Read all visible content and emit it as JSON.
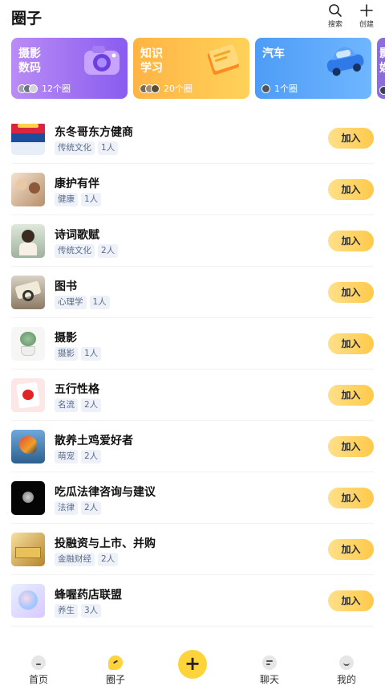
{
  "header": {
    "title": "圈子",
    "search_label": "搜索",
    "create_label": "创建"
  },
  "categories": [
    {
      "label": "摄影\n数码",
      "count": "12个圈",
      "color_from": "#b98cf5",
      "color_to": "#8a5cf0",
      "icon": "camera-icon"
    },
    {
      "label": "知识\n学习",
      "count": "20个圈",
      "color_from": "#ffb444",
      "color_to": "#ffd25a",
      "icon": "book-icon"
    },
    {
      "label": "汽车",
      "count": "1个圈",
      "color_from": "#4e9cf6",
      "color_to": "#6fb6ff",
      "icon": "car-icon"
    },
    {
      "label": "影\n娱",
      "count": "",
      "color_from": "#8e6fd8",
      "color_to": "#6d55c8",
      "icon": "film-icon"
    }
  ],
  "circles": [
    {
      "name": "东冬哥东方健商",
      "tags": [
        "传统文化",
        "1人"
      ],
      "join": "加入",
      "thumb": "poster"
    },
    {
      "name": "康护有伴",
      "tags": [
        "健康",
        "1人"
      ],
      "join": "加入",
      "thumb": "care"
    },
    {
      "name": "诗词歌赋",
      "tags": [
        "传统文化",
        "2人"
      ],
      "join": "加入",
      "thumb": "poetry"
    },
    {
      "name": "图书",
      "tags": [
        "心理学",
        "1人"
      ],
      "join": "加入",
      "thumb": "books"
    },
    {
      "name": "摄影",
      "tags": [
        "摄影",
        "1人"
      ],
      "join": "加入",
      "thumb": "succulent"
    },
    {
      "name": "五行性格",
      "tags": [
        "名流",
        "2人"
      ],
      "join": "加入",
      "thumb": "apple"
    },
    {
      "name": "散养土鸡爱好者",
      "tags": [
        "萌宠",
        "2人"
      ],
      "join": "加入",
      "thumb": "rooster"
    },
    {
      "name": "吃瓜法律咨询与建议",
      "tags": [
        "法律",
        "2人"
      ],
      "join": "加入",
      "thumb": "moon"
    },
    {
      "name": "投融资与上市、并购",
      "tags": [
        "金融财经",
        "2人"
      ],
      "join": "加入",
      "thumb": "gold"
    },
    {
      "name": "蜂喔药店联盟",
      "tags": [
        "养生",
        "3人"
      ],
      "join": "加入",
      "thumb": "brain"
    }
  ],
  "tabbar": {
    "home": "首页",
    "circle": "圈子",
    "add": "+",
    "chat": "聊天",
    "me": "我的"
  }
}
